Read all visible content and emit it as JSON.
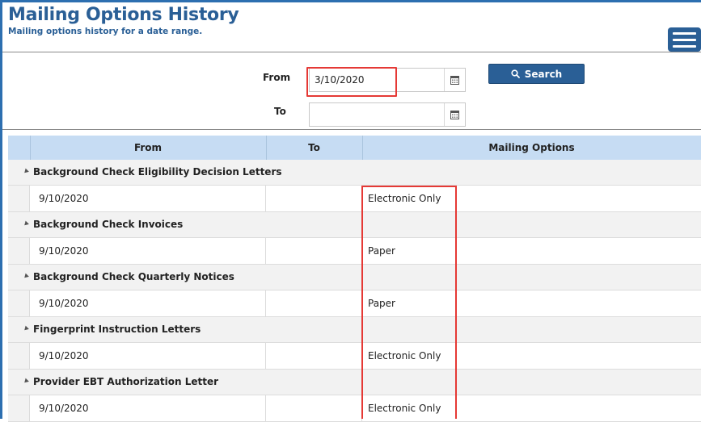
{
  "header": {
    "title": "Mailing Options History",
    "subtitle": "Mailing options history for a date range."
  },
  "filters": {
    "from_label": "From",
    "from_value": "3/10/2020",
    "to_label": "To",
    "to_value": "",
    "search_label": "Search"
  },
  "grid": {
    "columns": [
      "From",
      "To",
      "Mailing Options"
    ],
    "groups": [
      {
        "name": "Background Check Eligibility Decision Letters",
        "rows": [
          {
            "from": "9/10/2020",
            "to": "",
            "mailing": "Electronic Only"
          }
        ]
      },
      {
        "name": "Background Check Invoices",
        "rows": [
          {
            "from": "9/10/2020",
            "to": "",
            "mailing": "Paper"
          }
        ]
      },
      {
        "name": "Background Check Quarterly Notices",
        "rows": [
          {
            "from": "9/10/2020",
            "to": "",
            "mailing": "Paper"
          }
        ]
      },
      {
        "name": "Fingerprint Instruction Letters",
        "rows": [
          {
            "from": "9/10/2020",
            "to": "",
            "mailing": "Electronic Only"
          }
        ]
      },
      {
        "name": "Provider EBT Authorization Letter",
        "rows": [
          {
            "from": "9/10/2020",
            "to": "",
            "mailing": "Electronic Only"
          }
        ]
      }
    ]
  },
  "icons": {
    "menu": "hamburger-menu-icon",
    "calendar": "calendar-icon",
    "search": "search-icon",
    "collapse": "collapse-triangle-icon"
  },
  "colors": {
    "brand": "#2a5f96",
    "grid_header": "#c6dcf3",
    "group_row": "#f2f2f2",
    "highlight": "#e53935"
  }
}
